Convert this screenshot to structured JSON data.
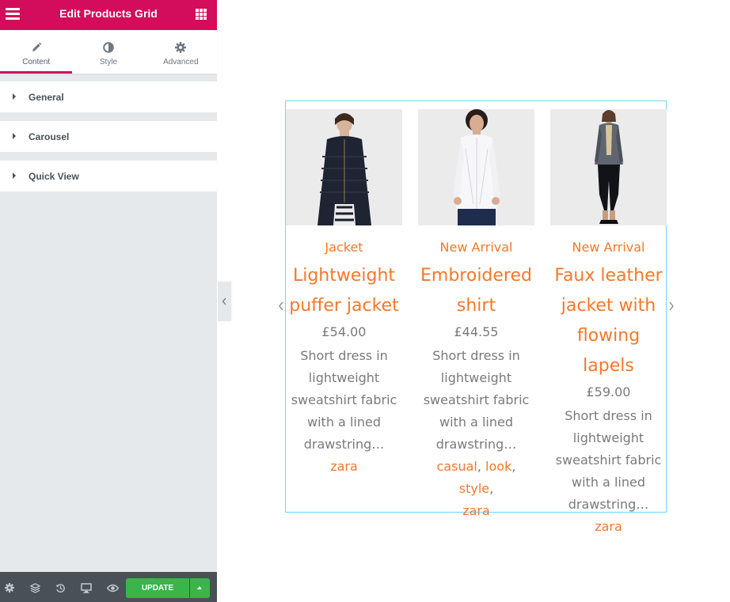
{
  "editor": {
    "title": "Edit Products Grid",
    "tabs": [
      {
        "label": "Content",
        "icon": "pencil-icon",
        "active": true
      },
      {
        "label": "Style",
        "icon": "contrast-icon",
        "active": false
      },
      {
        "label": "Advanced",
        "icon": "gear-icon",
        "active": false
      }
    ],
    "sections": [
      {
        "label": "General"
      },
      {
        "label": "Carousel"
      },
      {
        "label": "Quick View"
      }
    ],
    "footer": {
      "update_label": "UPDATE",
      "icons": [
        "settings-icon",
        "layers-icon",
        "history-icon",
        "responsive-icon",
        "preview-icon"
      ]
    },
    "accent_color": "#d30c5c",
    "update_color": "#39b54a"
  },
  "products": [
    {
      "category": "Jacket",
      "name_lines": [
        "Lightweight",
        "puffer jacket"
      ],
      "price": "£54.00",
      "desc_lines": [
        "Short dress in",
        "lightweight",
        "sweatshirt fabric",
        "with a lined",
        "drawstring…"
      ],
      "tags": [
        "zara"
      ]
    },
    {
      "category": "New Arrival",
      "name_lines": [
        "Embroidered",
        "shirt"
      ],
      "price": "£44.55",
      "desc_lines": [
        "Short dress in",
        "lightweight",
        "sweatshirt fabric",
        "with a lined",
        "drawstring…"
      ],
      "tags": [
        "casual",
        "look",
        "style",
        "zara"
      ]
    },
    {
      "category": "New Arrival",
      "name_lines": [
        "Faux leather",
        "jacket with",
        "flowing lapels"
      ],
      "price": "£59.00",
      "desc_lines": [
        "Short dress in",
        "lightweight",
        "sweatshirt fabric",
        "with a lined",
        "drawstring…"
      ],
      "tags": [
        "zara"
      ]
    }
  ],
  "colors": {
    "link": "#f5782a",
    "text": "#7a7a7a",
    "widget_border": "#71d7f7"
  }
}
